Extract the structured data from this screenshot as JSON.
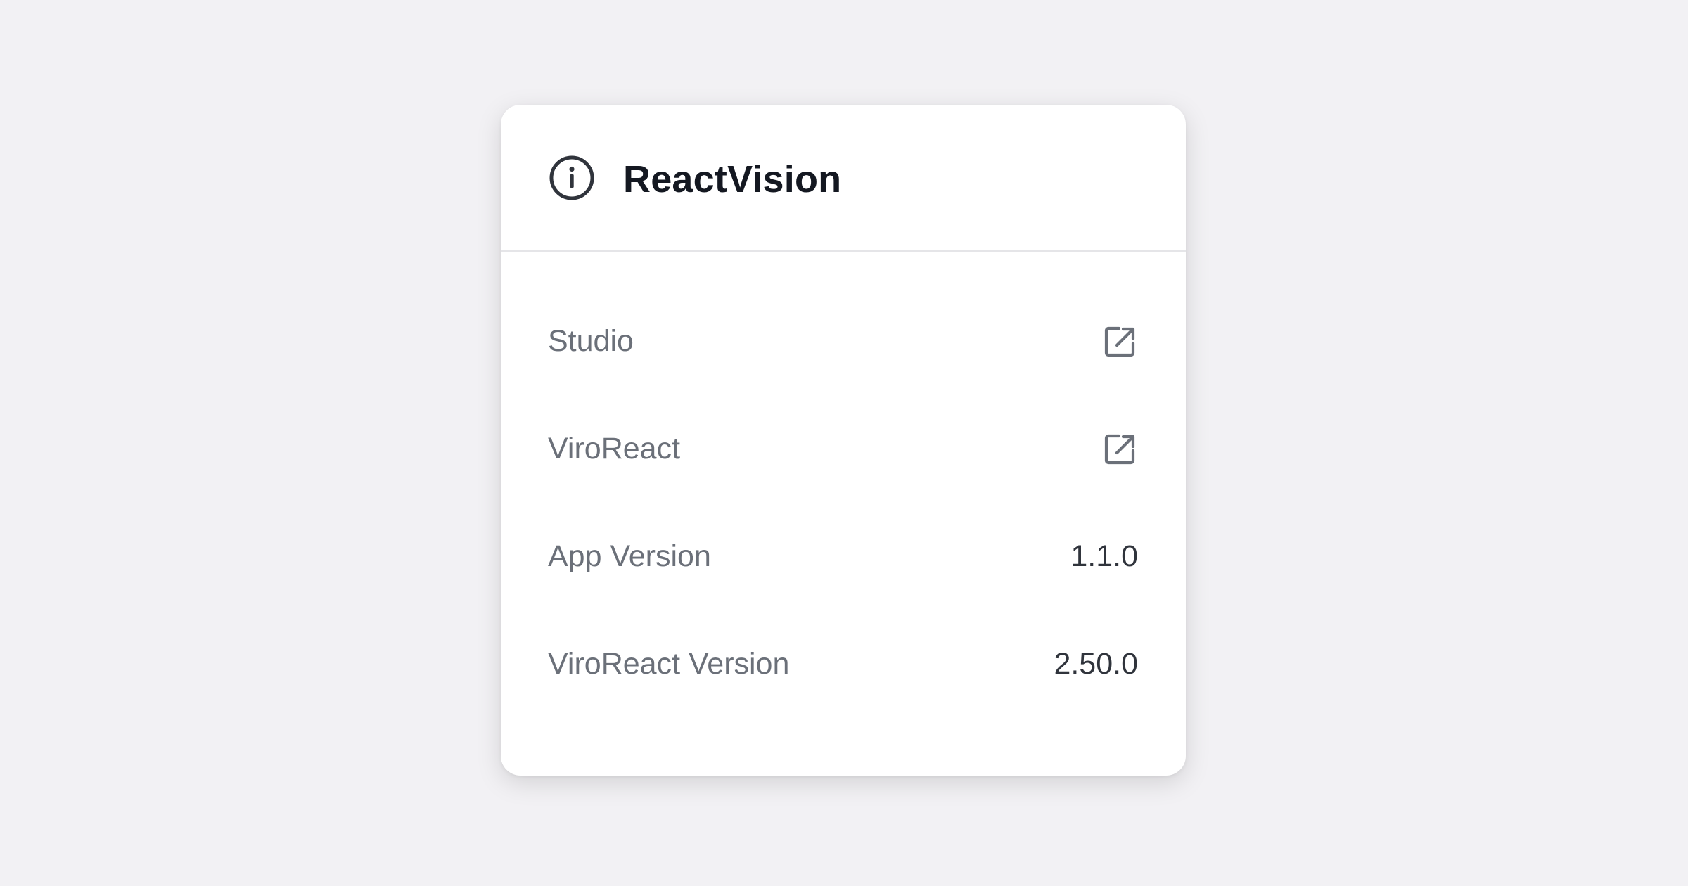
{
  "card": {
    "title": "ReactVision",
    "rows": [
      {
        "label": "Studio",
        "icon": "external-link-icon"
      },
      {
        "label": "ViroReact",
        "icon": "external-link-icon"
      },
      {
        "label": "App Version",
        "value": "1.1.0"
      },
      {
        "label": "ViroReact Version",
        "value": "2.50.0"
      }
    ]
  },
  "colors": {
    "page_bg": "#f2f1f4",
    "card_bg": "#ffffff",
    "title_text": "#141821",
    "label_text": "#6b7079",
    "value_text": "#30343c",
    "icon": "#6b7079",
    "divider": "#e5e5e8"
  },
  "header_icon": "info-circle-icon"
}
